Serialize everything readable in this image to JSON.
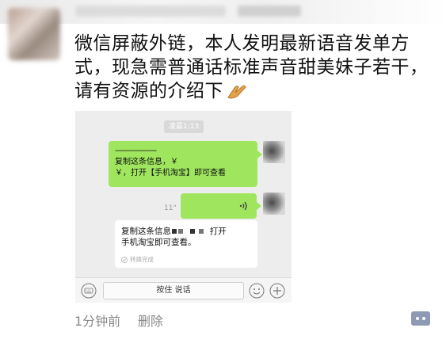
{
  "post": {
    "lines": [
      "微信屏蔽外链，本人发明最新语音发单方",
      "式，现急需普通话标准声音甜美妹子若干，",
      "请有资源的介绍下"
    ],
    "emoji_icon": "folded-hands-icon"
  },
  "screenshot": {
    "time_chip": "凌晨1:13",
    "bubble1_dashes": "--------------------",
    "bubble1_line1": "复制这条信息，￥",
    "bubble1_line2": "￥，打开【手机淘宝】即可查看",
    "voice_length": "11\"",
    "transcript_line1": "复制这条信息",
    "transcript_line1_tail": "打开",
    "transcript_line2": "手机淘宝即可查看。",
    "transcript_status": "转换完成",
    "hold_to_talk": "按住 说话"
  },
  "footer": {
    "time": "1分钟前",
    "delete": "删除"
  },
  "colors": {
    "bubble_green": "#9fe65e",
    "meta_gray": "#888888",
    "comment_button": "#8e9ab3"
  }
}
